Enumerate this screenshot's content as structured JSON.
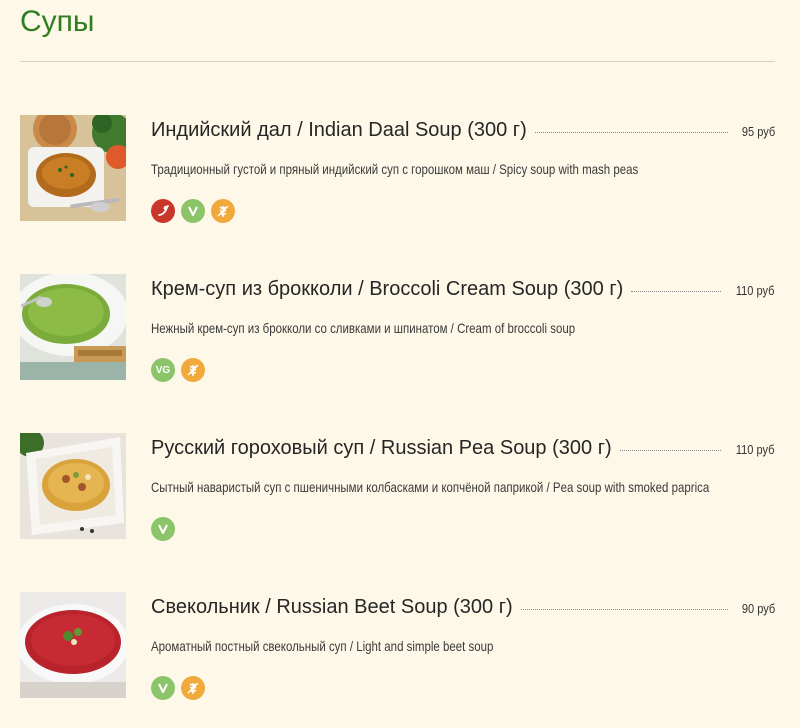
{
  "page": {
    "title": "Супы"
  },
  "colors": {
    "background": "#fdf8e7",
    "title": "#2e7d1f",
    "spicy": "#c9362a",
    "vegetarian": "#8cc46a",
    "gluten_free": "#f0a93a"
  },
  "items": [
    {
      "title": "Индийский дал / Indian Daal Soup (300 г)",
      "price": "95 руб",
      "description": "Традиционный густой и пряный индийский суп с горошком маш / Spicy soup with mash peas",
      "badges": [
        "spicy",
        "vegetarian",
        "gluten-free"
      ],
      "image": "indian-daal-soup-photo"
    },
    {
      "title": "Крем-суп из брокколи / Broccoli Cream Soup (300 г)",
      "price": "110 руб",
      "description": "Нежный крем-суп из брокколи со сливками и шпинатом / Cream of broccoli soup",
      "badges": [
        "vegan",
        "gluten-free"
      ],
      "badge_labels": {
        "vegan": "VG"
      },
      "image": "broccoli-cream-soup-photo"
    },
    {
      "title": "Русский гороховый суп / Russian Pea Soup (300 г)",
      "price": "110 руб",
      "description": "Сытный наваристый суп с пшеничными колбасками и копчёной паприкой / Pea soup with smoked paprica",
      "badges": [
        "vegetarian"
      ],
      "image": "russian-pea-soup-photo"
    },
    {
      "title": "Свекольник / Russian Beet Soup (300 г)",
      "price": "90 руб",
      "description": "Ароматный постный свекольный суп / Light and simple beet soup",
      "badges": [
        "vegetarian",
        "gluten-free"
      ],
      "image": "russian-beet-soup-photo"
    }
  ]
}
